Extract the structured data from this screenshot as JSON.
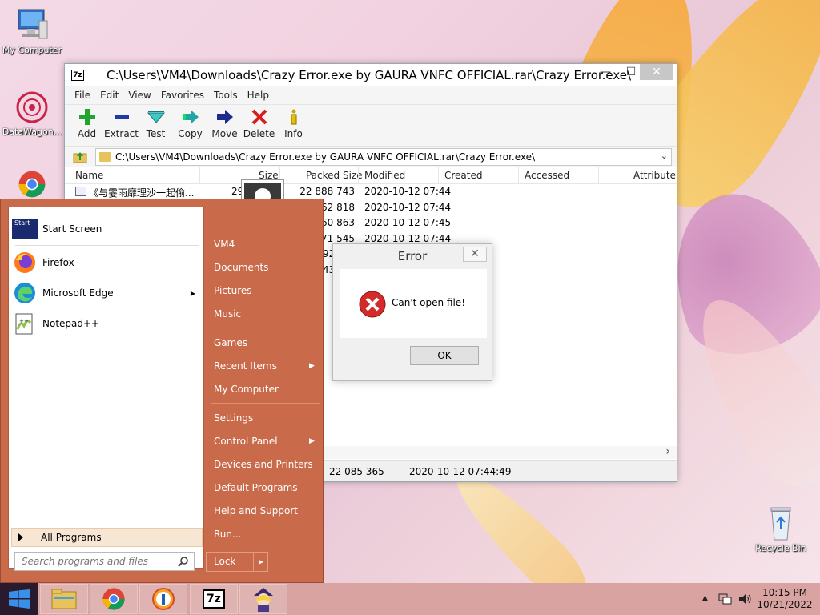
{
  "desktop": {
    "icons": [
      {
        "label": "My Computer"
      },
      {
        "label": "DataWagon..."
      },
      {
        "label": "Recycle Bin"
      }
    ]
  },
  "zip_window": {
    "title": "C:\\Users\\VM4\\Downloads\\Crazy Error.exe by GAURA VNFC OFFICIAL.rar\\Crazy Error.exe\\",
    "app_icon": "7z",
    "minimize": "—",
    "restore": "☐",
    "close": "✕",
    "menu": [
      "File",
      "Edit",
      "View",
      "Favorites",
      "Tools",
      "Help"
    ],
    "toolbar": {
      "add": "Add",
      "extract": "Extract",
      "test": "Test",
      "copy": "Copy",
      "move": "Move",
      "delete": "Delete",
      "info": "Info"
    },
    "address": "C:\\Users\\VM4\\Downloads\\Crazy Error.exe by GAURA VNFC OFFICIAL.rar\\Crazy Error.exe\\",
    "address_dropdown": "⌄",
    "columns": [
      "Name",
      "Size",
      "Packed Size",
      "Modified",
      "Created",
      "Accessed",
      "Attribute"
    ],
    "rows": [
      {
        "name": "《与霎雨靡理沙一起偷...",
        "size": "29",
        "packed": "22 888 743",
        "modified": "2020-10-12 07:44"
      },
      {
        "name": "",
        "size": "",
        "packed": "162 818",
        "modified": "2020-10-12 07:44"
      },
      {
        "name": "",
        "size": "",
        "packed": "560 863",
        "modified": "2020-10-12 07:45"
      },
      {
        "name": "",
        "size": "",
        "packed": "271 545",
        "modified": "2020-10-12 07:44"
      },
      {
        "name": "",
        "size": "",
        "packed": "92",
        "modified": ""
      },
      {
        "name": "",
        "size": "",
        "packed": "43",
        "modified": ""
      }
    ],
    "status": {
      "packed": "22 085 365",
      "modified": "2020-10-12 07:44:49"
    },
    "scroll_right": "›"
  },
  "error_dialog": {
    "title": "Error",
    "close": "✕",
    "message": "Can't open file!",
    "ok": "OK"
  },
  "start_menu": {
    "pinned": [
      {
        "label": "Start Screen",
        "icon_text": "Start"
      },
      {
        "label": "Firefox"
      },
      {
        "label": "Microsoft Edge"
      },
      {
        "label": "Notepad++"
      }
    ],
    "all_programs": "All Programs",
    "search_placeholder": "Search programs and files",
    "right_items": [
      {
        "label": "VM4"
      },
      {
        "label": "Documents"
      },
      {
        "label": "Pictures"
      },
      {
        "label": "Music"
      },
      {
        "label": "Games"
      },
      {
        "label": "Recent Items"
      },
      {
        "label": "My Computer"
      },
      {
        "label": "Settings"
      },
      {
        "label": "Control Panel"
      },
      {
        "label": "Devices and Printers"
      },
      {
        "label": "Default Programs"
      },
      {
        "label": "Help and Support"
      },
      {
        "label": "Run..."
      }
    ],
    "lock": "Lock",
    "submenu_arrow": "▶",
    "lock_arrow": "▸"
  },
  "taskbar": {
    "apps": [
      "File Explorer",
      "Chrome",
      "Browser",
      "7-Zip",
      "Character"
    ],
    "app_7z_label": "7z",
    "tray_chevron": "▲",
    "time": "10:15 PM",
    "date": "10/21/2022"
  }
}
